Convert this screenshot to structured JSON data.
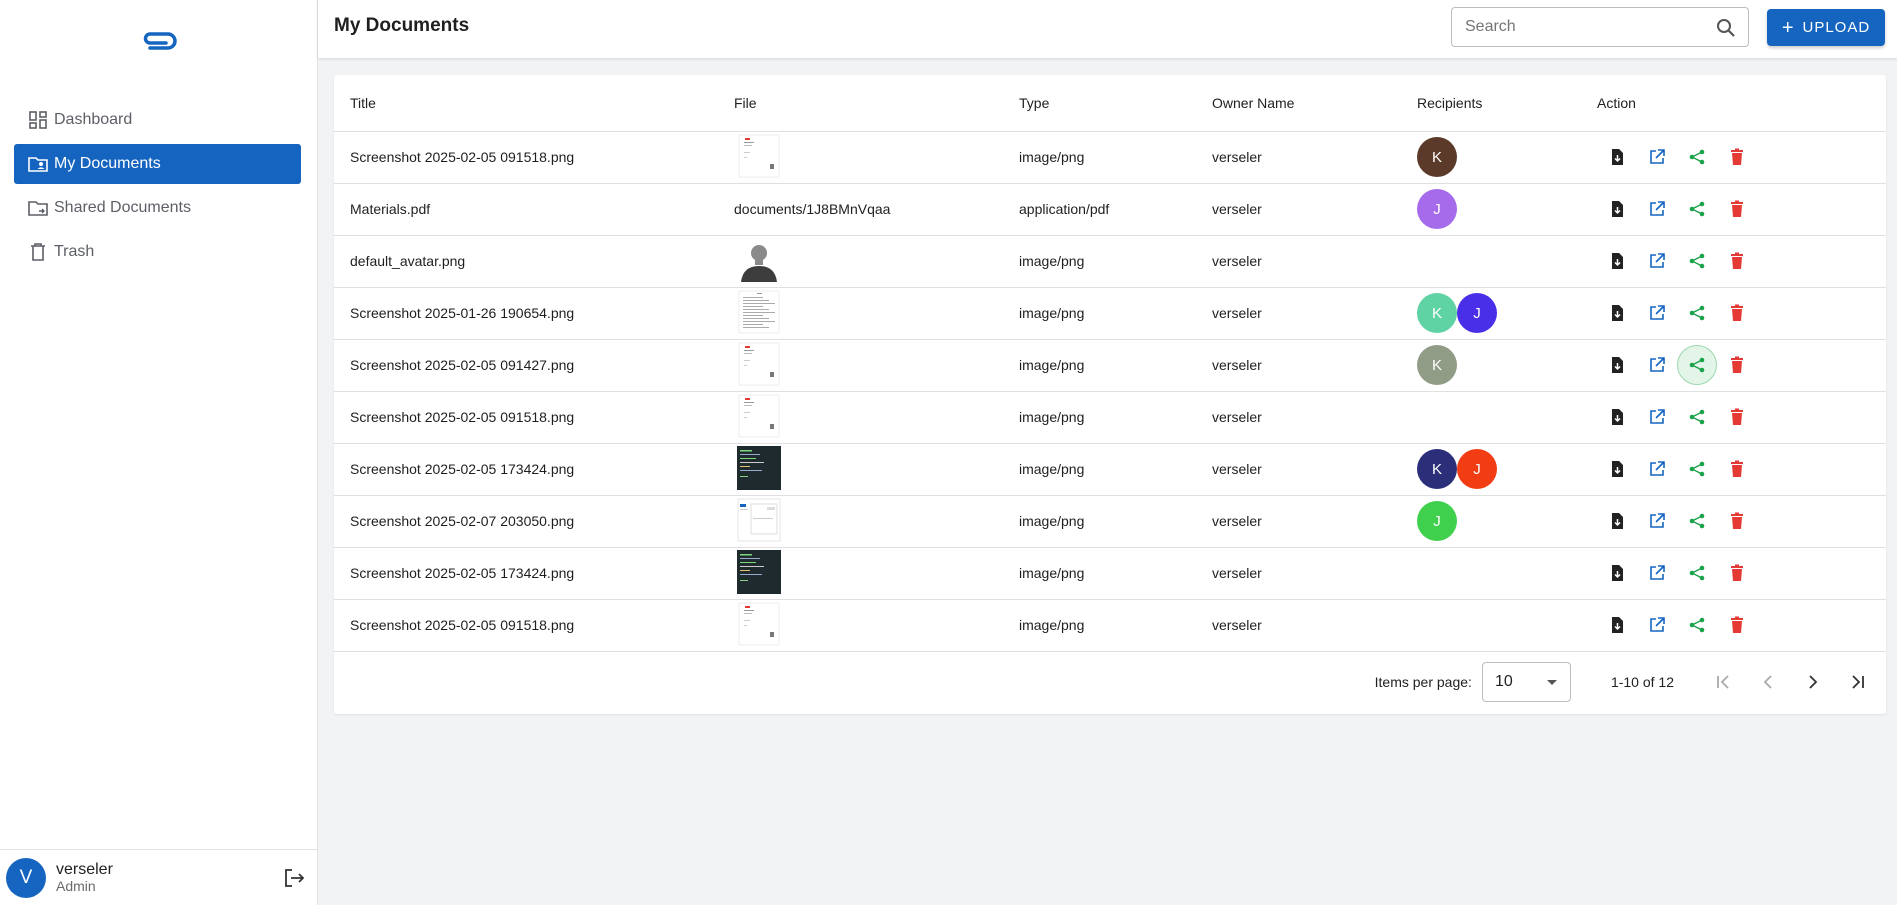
{
  "sidebar": {
    "items": [
      {
        "label": "Dashboard",
        "icon": "dashboard-icon"
      },
      {
        "label": "My Documents",
        "icon": "folder-account-icon"
      },
      {
        "label": "Shared Documents",
        "icon": "folder-shared-icon"
      },
      {
        "label": "Trash",
        "icon": "trash-icon"
      }
    ],
    "active_index": 1,
    "user": {
      "initial": "V",
      "name": "verseler",
      "role": "Admin"
    }
  },
  "header": {
    "title": "My Documents",
    "search_placeholder": "Search",
    "upload_label": "UPLOAD"
  },
  "colors": {
    "primary": "#1565c0",
    "action_download": "#222222",
    "action_open": "#1565c0",
    "action_share": "#1aa34a",
    "action_delete": "#e53935"
  },
  "table": {
    "columns": [
      "Title",
      "File",
      "Type",
      "Owner Name",
      "Recipients",
      "Action"
    ],
    "rows": [
      {
        "title": "Screenshot 2025-02-05 091518.png",
        "file": "",
        "thumb": "doc-red",
        "type": "image/png",
        "owner": "verseler",
        "recipients": [
          {
            "initial": "K",
            "color": "#5b3a29"
          }
        ]
      },
      {
        "title": "Materials.pdf",
        "file": "documents/1J8BMnVqaa",
        "thumb": "",
        "type": "application/pdf",
        "owner": "verseler",
        "recipients": [
          {
            "initial": "J",
            "color": "#a66bea"
          }
        ]
      },
      {
        "title": "default_avatar.png",
        "file": "",
        "thumb": "person",
        "type": "image/png",
        "owner": "verseler",
        "recipients": []
      },
      {
        "title": "Screenshot 2025-01-26 190654.png",
        "file": "",
        "thumb": "doc-text",
        "type": "image/png",
        "owner": "verseler",
        "recipients": [
          {
            "initial": "K",
            "color": "#5fd3a3"
          },
          {
            "initial": "J",
            "color": "#4a2fe8"
          }
        ]
      },
      {
        "title": "Screenshot 2025-02-05 091427.png",
        "file": "",
        "thumb": "doc-red",
        "type": "image/png",
        "owner": "verseler",
        "recipients": [
          {
            "initial": "K",
            "color": "#919c86"
          }
        ]
      },
      {
        "title": "Screenshot 2025-02-05 091518.png",
        "file": "",
        "thumb": "doc-red",
        "type": "image/png",
        "owner": "verseler",
        "recipients": []
      },
      {
        "title": "Screenshot 2025-02-05 173424.png",
        "file": "",
        "thumb": "terminal",
        "type": "image/png",
        "owner": "verseler",
        "recipients": [
          {
            "initial": "K",
            "color": "#2b2f7a"
          },
          {
            "initial": "J",
            "color": "#f23d14"
          }
        ]
      },
      {
        "title": "Screenshot 2025-02-07 203050.png",
        "file": "",
        "thumb": "ui",
        "type": "image/png",
        "owner": "verseler",
        "recipients": [
          {
            "initial": "J",
            "color": "#3fd14d"
          }
        ]
      },
      {
        "title": "Screenshot 2025-02-05 173424.png",
        "file": "",
        "thumb": "terminal",
        "type": "image/png",
        "owner": "verseler",
        "recipients": []
      },
      {
        "title": "Screenshot 2025-02-05 091518.png",
        "file": "",
        "thumb": "doc-red",
        "type": "image/png",
        "owner": "verseler",
        "recipients": []
      }
    ],
    "highlighted_share_row": 4
  },
  "paginator": {
    "items_per_page_label": "Items per page:",
    "items_per_page": "10",
    "range_label": "1-10 of 12"
  }
}
